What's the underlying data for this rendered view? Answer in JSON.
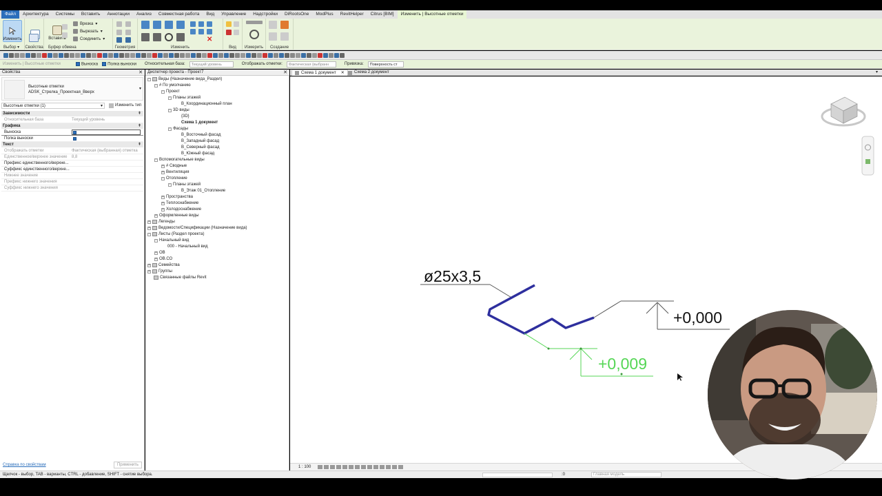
{
  "ribbon_tabs": [
    "Файл",
    "Архитектура",
    "Системы",
    "Вставить",
    "Аннотации",
    "Анализ",
    "Совместная работа",
    "Вид",
    "Управление",
    "Надстройки",
    "DiRootsOne",
    "ModPlus",
    "RevitHelper",
    "Citrus [BIM]",
    "Изменить | Высотные отметки"
  ],
  "ribbon": {
    "modify_label": "Изменить",
    "select_label": "Выбор",
    "properties_label": "Свойства",
    "paste_label": "Вставить",
    "clipboard_label": "Буфер обмена",
    "cut_label": "Врезка",
    "cut2_label": "Вырезать",
    "join_label": "Соединить",
    "geometry_label": "Геометрия",
    "modify_group_label": "Изменить",
    "view_label": "Вид",
    "measure_label": "Измерить",
    "create_label": "Создание"
  },
  "options_bar": {
    "context": "Изменить | Высотные отметки",
    "leader": "Выноска",
    "shoulder": "Полка выноски",
    "rel_base_label": "Относительная база:",
    "rel_base_value": "Текущий уровень",
    "display_label": "Отображать отметки:",
    "display_value": "Фактическая (выбранн",
    "snap_label": "Привязка:",
    "snap_value": "Поверхность ст"
  },
  "properties": {
    "title": "Свойства",
    "family": "Высотные отметки",
    "type": "ADSK_Стрелка_Проектная_Вверх",
    "selection": "Высотные отметки (1)",
    "edit_type": "Изменить тип",
    "categories": [
      {
        "name": "Зависимости",
        "rows": [
          {
            "k": "Относительная база",
            "v": "Текущий уровень",
            "dim": true
          }
        ]
      },
      {
        "name": "Графика",
        "rows": [
          {
            "k": "Выноска",
            "v": "",
            "dim": false
          },
          {
            "k": "Полка выноски",
            "v": "",
            "dim": false
          }
        ]
      },
      {
        "name": "Текст",
        "rows": [
          {
            "k": "Отображать отметки",
            "v": "Фактическая (выбранная) отметка",
            "dim": true
          },
          {
            "k": "Единственное/верхнее значение",
            "v": "8,8",
            "dim": true
          },
          {
            "k": "Префикс единственного/верхне...",
            "v": "",
            "dim": false
          },
          {
            "k": "Суффикс единственного/верхне...",
            "v": "",
            "dim": false
          },
          {
            "k": "Нижнее значение",
            "v": "",
            "dim": true
          },
          {
            "k": "Префикс нижнего значения",
            "v": "",
            "dim": true
          },
          {
            "k": "Суффикс нижнего значения",
            "v": "",
            "dim": true
          }
        ]
      }
    ],
    "help_link": "Справка по свойствам",
    "apply": "Применить"
  },
  "browser": {
    "title": "Диспетчер проекта - Проект7",
    "nodes": [
      {
        "t": "Виды (Назначение вида_Раздел)",
        "l": 0,
        "pm": "-",
        "icon": true
      },
      {
        "t": "# По умолчанию",
        "l": 1,
        "pm": "-"
      },
      {
        "t": "Проект",
        "l": 2,
        "pm": "-"
      },
      {
        "t": "Планы этажей",
        "l": 3,
        "pm": "-"
      },
      {
        "t": "В_Координационный план",
        "l": 4
      },
      {
        "t": "3D виды",
        "l": 3,
        "pm": "-"
      },
      {
        "t": "{3D}",
        "l": 4
      },
      {
        "t": "Схема 1 документ",
        "l": 4,
        "bold": true
      },
      {
        "t": "Фасады",
        "l": 3,
        "pm": "-"
      },
      {
        "t": "В_Восточный фасад",
        "l": 4
      },
      {
        "t": "В_Западный фасад",
        "l": 4
      },
      {
        "t": "В_Северный фасад",
        "l": 4
      },
      {
        "t": "В_Южный фасад",
        "l": 4
      },
      {
        "t": "Вспомогательные виды",
        "l": 1,
        "pm": "-"
      },
      {
        "t": "# Сводные",
        "l": 2,
        "pm": "+"
      },
      {
        "t": "Вентиляция",
        "l": 2,
        "pm": "+"
      },
      {
        "t": "Отопление",
        "l": 2,
        "pm": "-"
      },
      {
        "t": "Планы этажей",
        "l": 3,
        "pm": "-"
      },
      {
        "t": "В_Этаж 01_Отопление",
        "l": 4
      },
      {
        "t": "Пространства",
        "l": 2,
        "pm": "+"
      },
      {
        "t": "Теплоснабжение",
        "l": 2,
        "pm": "+"
      },
      {
        "t": "Холодоснабжение",
        "l": 2,
        "pm": "+"
      },
      {
        "t": "Оформленные виды",
        "l": 1,
        "pm": "+"
      },
      {
        "t": "Легенды",
        "l": 0,
        "pm": "+",
        "icon": true
      },
      {
        "t": "Ведомости/Спецификации (Назначение вида)",
        "l": 0,
        "pm": "+",
        "icon": true
      },
      {
        "t": "Листы (Раздел проекта)",
        "l": 0,
        "pm": "-",
        "icon": true
      },
      {
        "t": "Начальный вид",
        "l": 1,
        "pm": "-"
      },
      {
        "t": "000 - Начальный вид",
        "l": 2
      },
      {
        "t": "ОВ",
        "l": 1,
        "pm": "+"
      },
      {
        "t": "ОВ.СО",
        "l": 1,
        "pm": "+"
      },
      {
        "t": "Семейства",
        "l": 0,
        "pm": "+",
        "icon": true
      },
      {
        "t": "Группы",
        "l": 0,
        "pm": "+",
        "icon": true
      },
      {
        "t": "Связанные файлы Revit",
        "l": 0,
        "pm": "",
        "icon": true
      }
    ]
  },
  "view_tabs": [
    {
      "label": "Схема 1 документ",
      "active": true
    },
    {
      "label": "Схема 2 документ",
      "active": false
    }
  ],
  "canvas": {
    "pipe_tag": "ø25x3,5",
    "elev_top": "+0,000",
    "elev_selected": "+0,009",
    "scale": "1 : 100"
  },
  "status": {
    "hint": "Щелчок - выбор, TAB - варианты, CTRL - добавление, SHIFT - снятие выбора.",
    "zero": ":0",
    "model": "Главная модель"
  },
  "colors": {
    "pipe": "#2e2f9e",
    "selected": "#55d655",
    "ribbon_bg": "#eaf3dc",
    "file_tab": "#2a6ebb"
  }
}
